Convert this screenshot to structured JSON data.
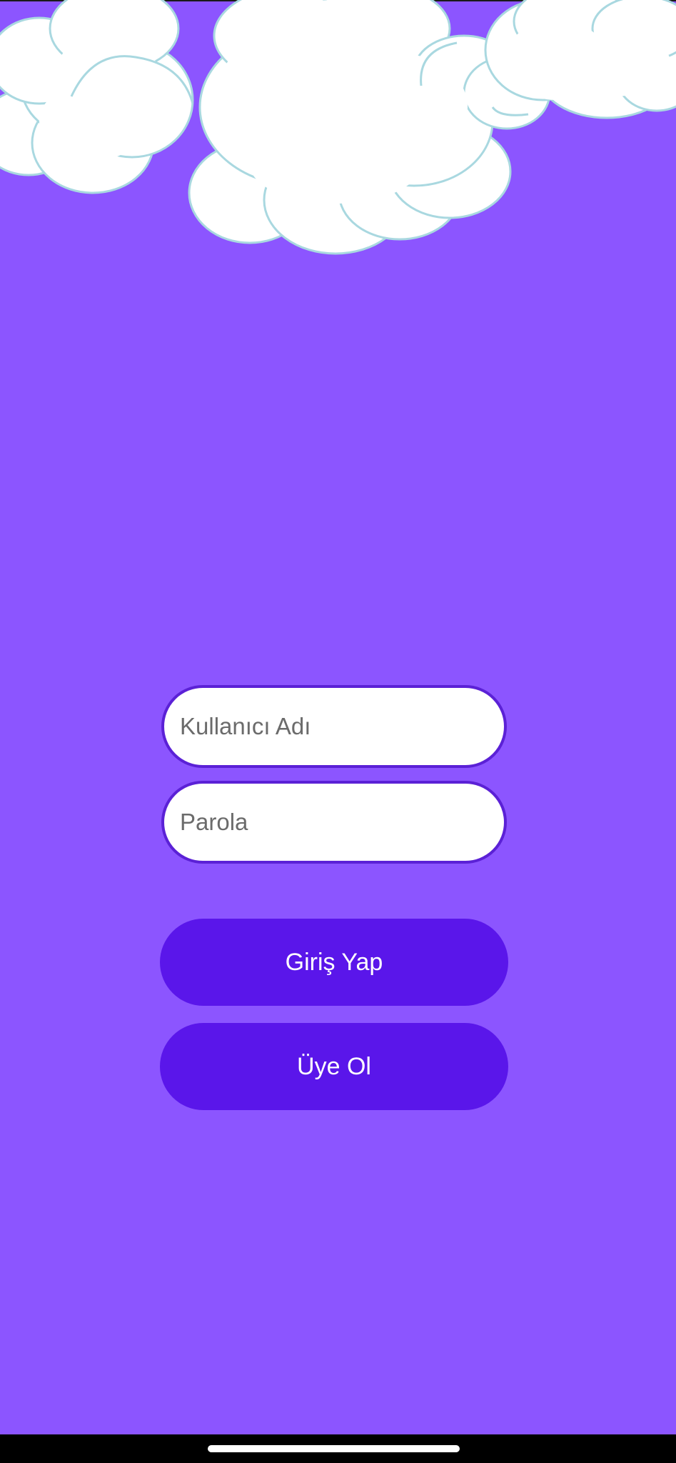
{
  "colors": {
    "background": "#8c55ff",
    "field_border": "#5b21d6",
    "field_fill": "#ffffff",
    "button_fill": "#5a16ea",
    "button_text": "#ffffff",
    "cloud_fill": "#ffffff",
    "cloud_outline": "#a9d8e0"
  },
  "login_form": {
    "username": {
      "placeholder": "Kullanıcı Adı",
      "value": ""
    },
    "password": {
      "placeholder": "Parola",
      "value": ""
    },
    "login_button_label": "Giriş Yap",
    "signup_button_label": "Üye Ol"
  },
  "decoration": {
    "top_graphic": "cloud-illustration"
  }
}
